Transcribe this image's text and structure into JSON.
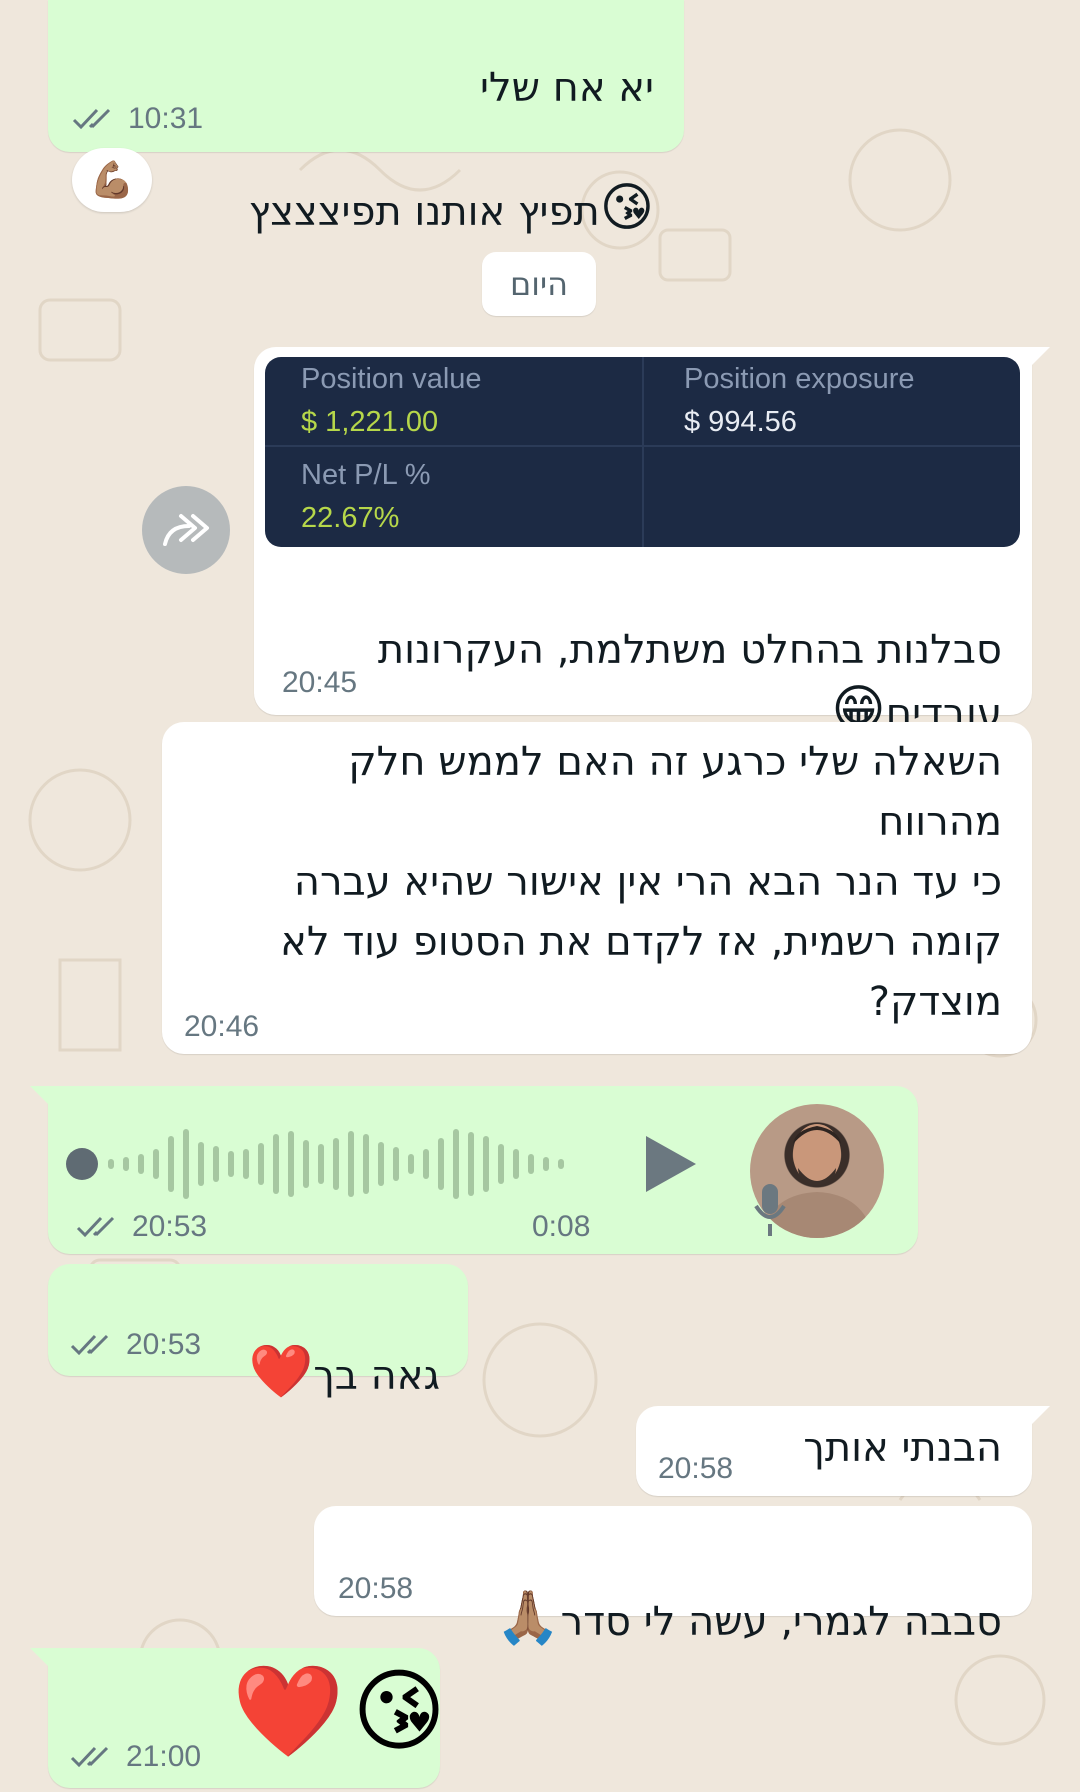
{
  "messages": {
    "m1": {
      "lines": [
        "יא אח שלי",
        "תפיץ אותנו תפיצצצץ"
      ],
      "emoji": "😘",
      "time": "10:31",
      "reaction": "💪🏽"
    },
    "day_separator": "היום",
    "m2": {
      "card": {
        "position_value_label": "Position value",
        "position_value": "$ 1,221.00",
        "position_exposure_label": "Position exposure",
        "position_exposure": "$ 994.56",
        "net_pl_label": "Net P/L %",
        "net_pl": "22.67%"
      },
      "text": "סבלנות בהחלט משתלמת, העקרונות\nעובדים",
      "emoji": "😁",
      "time": "20:45"
    },
    "m3": {
      "text": "השאלה שלי כרגע זה האם לממש חלק\nמהרווח\n כי עד הנר הבא הרי אין אישור שהיא עברה\nקומה רשמית, אז לקדם את הסטופ עוד לא\nמוצדק?",
      "time": "20:46"
    },
    "voice": {
      "time": "20:53",
      "duration": "0:08"
    },
    "m4": {
      "text": "גאה בך",
      "emoji": "❤️",
      "time": "20:53"
    },
    "m5": {
      "text": "הבנתי אותך",
      "time": "20:58"
    },
    "m6": {
      "text": "סבבה לגמרי, עשה לי סדר",
      "emoji": "🙏🏽",
      "time": "20:58"
    },
    "m7": {
      "emoji1": "❤️",
      "emoji2": "😘",
      "time": "21:00"
    }
  },
  "colors": {
    "outgoing": "#d9fdd3",
    "incoming": "#ffffff",
    "read_ticks": "#667781",
    "card_bg": "#1c2a44",
    "card_green": "#b6d74a"
  }
}
